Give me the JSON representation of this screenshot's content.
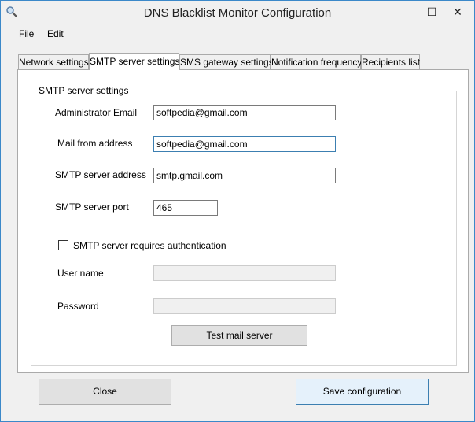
{
  "window": {
    "title": "DNS Blacklist Monitor Configuration",
    "minimize": "—",
    "maximize": "☐",
    "close": "✕"
  },
  "menu": [
    "File",
    "Edit"
  ],
  "tabs": [
    {
      "label": "Network settings",
      "active": false
    },
    {
      "label": "SMTP server settings",
      "active": true
    },
    {
      "label": "SMS gateway settings",
      "active": false
    },
    {
      "label": "Notification frequency",
      "active": false
    },
    {
      "label": "Recipients list",
      "active": false
    }
  ],
  "smtp": {
    "group_title": "SMTP server settings",
    "admin_email_label": "Administrator Email",
    "admin_email_value": "softpedia@gmail.com",
    "mail_from_label": "Mail from address",
    "mail_from_value": "softpedia@gmail.com",
    "server_address_label": "SMTP server address",
    "server_address_value": "smtp.gmail.com",
    "server_port_label": "SMTP server port",
    "server_port_value": "465",
    "requires_auth_label": "SMTP server requires authentication",
    "requires_auth_checked": false,
    "username_label": "User name",
    "username_value": "",
    "password_label": "Password",
    "password_value": "",
    "test_button": "Test mail server"
  },
  "footer": {
    "close_button": "Close",
    "save_button": "Save configuration"
  }
}
